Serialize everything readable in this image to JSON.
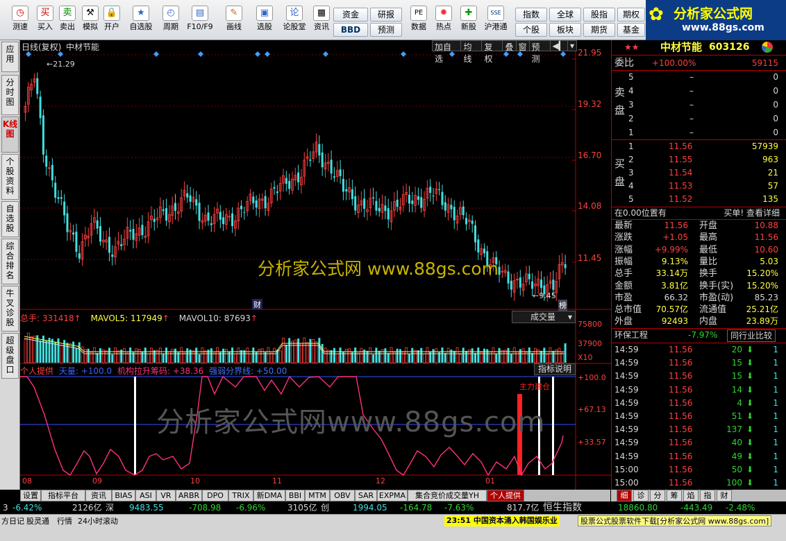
{
  "toolbar": {
    "items": [
      "测速",
      "买入",
      "卖出",
      "模拟",
      "开户",
      "自选股",
      "周期",
      "F10/F9",
      "画线",
      "选股",
      "论股堂",
      "资讯",
      "数据",
      "热点",
      "新股",
      "沪港通"
    ],
    "quick": [
      "资金",
      "研报",
      "BBD",
      "预测",
      "指数",
      "全球",
      "股指",
      "期权",
      "个股",
      "板块",
      "期货",
      "基金"
    ]
  },
  "logo": {
    "title": "分析家公式网",
    "url": "www.88gs.com"
  },
  "left_tabs": [
    "应用",
    "分时图",
    "K线图",
    "个股资料",
    "自选股",
    "综合排名",
    "牛叉诊股",
    "超级盘口"
  ],
  "chart": {
    "title": "日线(复权)",
    "stock": "中材节能",
    "buttons": [
      "加自选",
      "均线",
      "复权",
      "叠",
      "窗",
      "预测"
    ],
    "price_labels": [
      "21.95",
      "19.32",
      "16.70",
      "14.08",
      "11.45"
    ],
    "high_mark": "21.29",
    "low_mark": "9.45",
    "cai": "财",
    "bang": "榜",
    "watermark1": "分析家公式网  www.88gs.com",
    "watermark2": "分析家公式网www.88gs.com",
    "vol_title": "总手: 331418",
    "mavol5": "MAVOL5: 117949",
    "mavol10": "MAVOL10: 87693",
    "vol_select": "成交量",
    "vol_labels": [
      "75800",
      "37900",
      "X10"
    ],
    "ind_title": "个人提供",
    "ind_series": [
      "天量: +100.0",
      "机构拉升筹码: +38.36",
      "强弱分界线: +50.00"
    ],
    "ind_btn": "指标说明",
    "ind_labels": [
      "+100.0",
      "+67.13",
      "+33.57"
    ],
    "main_force": "主力建仓",
    "months": [
      "08",
      "09",
      "10",
      "11",
      "12",
      "01"
    ]
  },
  "chart_data": {
    "type": "candlestick",
    "title": "中材节能 日线(复权)",
    "ylim": [
      9.0,
      22.5
    ],
    "high": 21.29,
    "low": 9.45,
    "last": 11.56
  },
  "quote": {
    "name": "中材节能",
    "code": "603126",
    "weibi_label": "委比",
    "weibi": "+100.00%",
    "weicha": "59115",
    "sell_label": "卖盘",
    "buy_label": "买盘",
    "sell": [
      [
        "5",
        "–",
        "0"
      ],
      [
        "4",
        "–",
        "0"
      ],
      [
        "3",
        "–",
        "0"
      ],
      [
        "2",
        "–",
        "0"
      ],
      [
        "1",
        "–",
        "0"
      ]
    ],
    "buy": [
      [
        "1",
        "11.56",
        "57939"
      ],
      [
        "2",
        "11.55",
        "963"
      ],
      [
        "3",
        "11.54",
        "21"
      ],
      [
        "4",
        "11.53",
        "57"
      ],
      [
        "5",
        "11.52",
        "135"
      ]
    ],
    "pos": "在0.00位置有",
    "pos_r": "买单! 查看详细",
    "stats": [
      [
        "最新",
        "11.56",
        "开盘",
        "10.88"
      ],
      [
        "涨跌",
        "+1.05",
        "最高",
        "11.56"
      ],
      [
        "涨幅",
        "+9.99%",
        "最低",
        "10.60"
      ],
      [
        "振幅",
        "9.13%",
        "量比",
        "5.03"
      ],
      [
        "总手",
        "33.14万",
        "换手",
        "15.20%"
      ],
      [
        "金额",
        "3.81亿",
        "换手(实)",
        "15.20%"
      ],
      [
        "市盈",
        "66.32",
        "市盈(动)",
        "85.23"
      ],
      [
        "总市值",
        "70.57亿",
        "流通值",
        "25.21亿"
      ],
      [
        "外盘",
        "92493",
        "内盘",
        "23.89万"
      ]
    ],
    "industry": "环保工程",
    "industry_pct": "-7.97%",
    "compare": "同行业比较",
    "ticks": [
      [
        "14:59",
        "11.56",
        "20",
        "1"
      ],
      [
        "14:59",
        "11.56",
        "15",
        "1"
      ],
      [
        "14:59",
        "11.56",
        "15",
        "1"
      ],
      [
        "14:59",
        "11.56",
        "14",
        "1"
      ],
      [
        "14:59",
        "11.56",
        "4",
        "1"
      ],
      [
        "14:59",
        "11.56",
        "51",
        "1"
      ],
      [
        "14:59",
        "11.56",
        "137",
        "1"
      ],
      [
        "14:59",
        "11.56",
        "40",
        "1"
      ],
      [
        "14:59",
        "11.56",
        "49",
        "1"
      ],
      [
        "15:00",
        "11.56",
        "50",
        "1"
      ],
      [
        "15:00",
        "11.56",
        "100",
        "1"
      ]
    ]
  },
  "bottom_tabs": [
    "设置",
    "指标平台",
    "资讯",
    "BIAS",
    "ASI",
    "VR",
    "ARBR",
    "DPO",
    "TRIX",
    "新DMA",
    "BBI",
    "MTM",
    "OBV",
    "SAR",
    "EXPMA",
    "集合竞价成交量YH",
    "个人提供"
  ],
  "right_tabs": [
    "细",
    "诊",
    "分",
    "筹",
    "焰",
    "指",
    "财"
  ],
  "status": [
    "3",
    "-6.42%",
    "2126亿",
    "深",
    "9483.55",
    "-708.98",
    "-6.96%",
    "3105亿",
    "创",
    "1994.05",
    "-164.78",
    "-7.63%",
    "817.7亿",
    "恒生指数",
    "18860.80",
    "-443.49",
    "-2.48%"
  ],
  "status2": [
    "方日记",
    "股灵通",
    "行情",
    "24小时滚动"
  ],
  "ticker": "23:51 中国资本涌入韩国娱乐业",
  "ad": "股票公式股票软件下载[分析家公式网 www.88gs.com]"
}
